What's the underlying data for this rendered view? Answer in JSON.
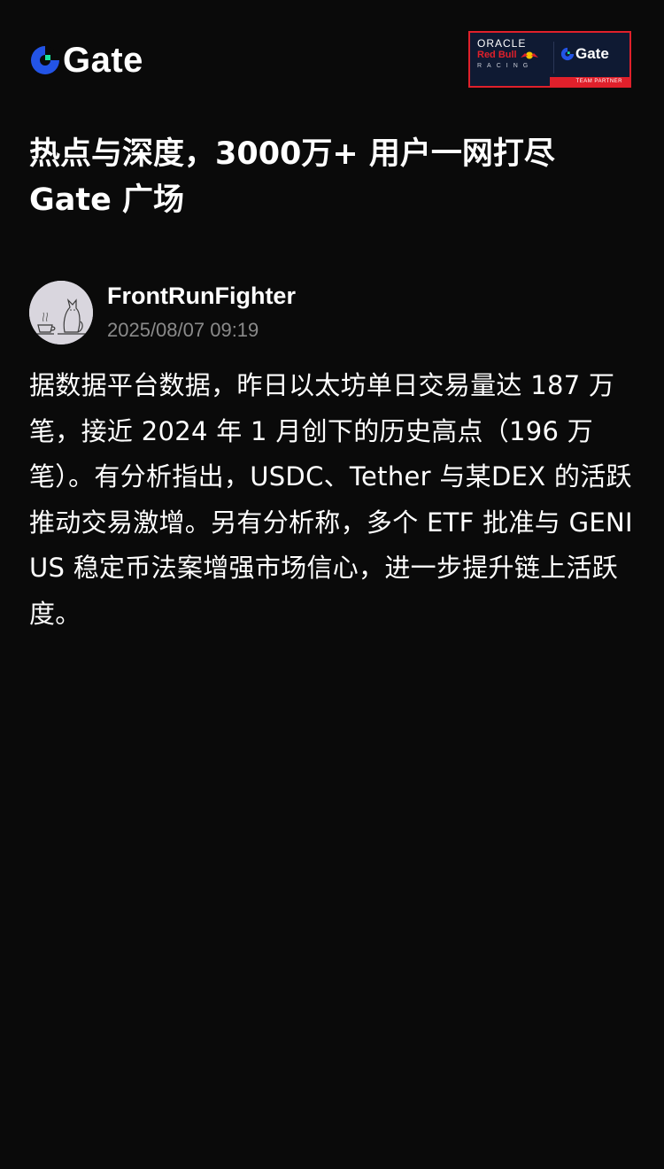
{
  "header": {
    "logo_text": "Gate",
    "logo_icon": "gate-logo-icon",
    "partner": {
      "oracle": "ORACLE",
      "redbull": "Red Bull",
      "racing": "RACING",
      "gate": "Gate",
      "team_partner": "TEAM PARTNER"
    }
  },
  "headline": "热点与深度，3000万+ 用户一网打尽 Gate 广场",
  "post": {
    "author_name": "FrontRunFighter",
    "timestamp": "2025/08/07 09:19",
    "body": "据数据平台数据，昨日以太坊单日交易量达 187 万笔，接近 2024 年 1 月创下的历史高点（196 万笔）。有分析指出，USDC、Tether 与某DEX 的活跃推动交易激增。另有分析称，多个 ETF 批准与 GENIUS 稳定币法案增强市场信心，进一步提升链上活跃度。"
  },
  "colors": {
    "background": "#0a0a0a",
    "text": "#ffffff",
    "muted": "#8a8a8a",
    "gate_blue": "#2354e6",
    "gate_green": "#17e6a1",
    "partner_red": "#e0202b",
    "partner_navy": "#0f1a33"
  }
}
